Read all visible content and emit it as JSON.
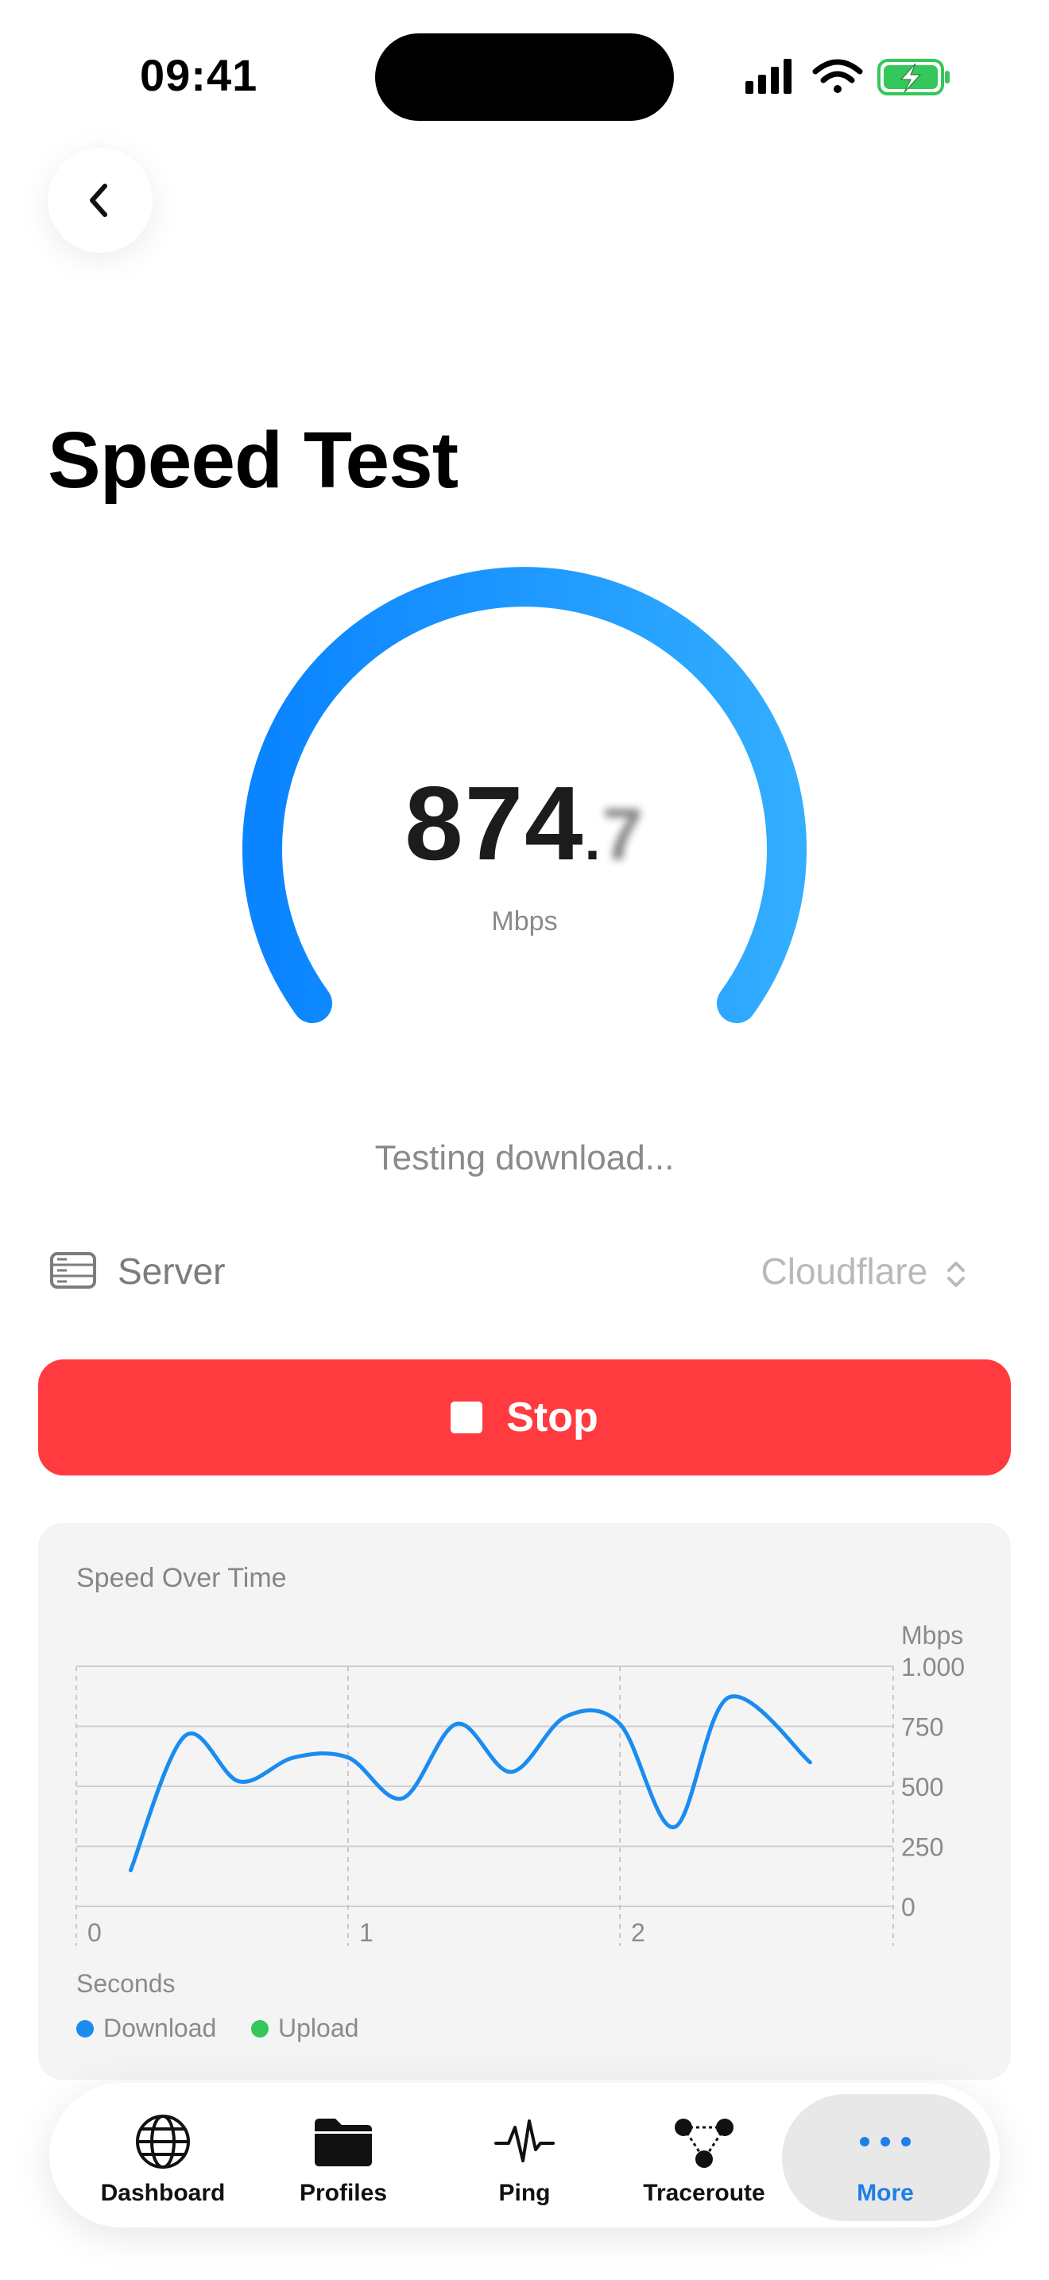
{
  "status_bar": {
    "time": "09:41"
  },
  "page": {
    "title": "Speed Test"
  },
  "gauge": {
    "speed_main": "874",
    "speed_dot": ".",
    "speed_decimal": "7",
    "unit": "Mbps",
    "accent_start": "#0a84ff",
    "accent_end": "#32adff"
  },
  "status": {
    "text": "Testing download..."
  },
  "server": {
    "label": "Server",
    "value": "Cloudflare",
    "icon": "server-icon"
  },
  "stop_button": {
    "label": "Stop",
    "color": "#ff3b3f"
  },
  "chart_data": {
    "type": "line",
    "title": "Speed Over Time",
    "xlabel": "Seconds",
    "ylabel": "Mbps",
    "x_ticks": [
      "0",
      "1",
      "2"
    ],
    "y_ticks": [
      "1.000",
      "750",
      "500",
      "250",
      "0"
    ],
    "ylim": [
      0,
      1000
    ],
    "xlim": [
      0,
      3
    ],
    "grid": true,
    "legend": "bottom-left",
    "series": [
      {
        "name": "Download",
        "color": "#1a8cf0",
        "points": [
          [
            0.2,
            150
          ],
          [
            0.4,
            710
          ],
          [
            0.6,
            520
          ],
          [
            0.8,
            620
          ],
          [
            1.0,
            620
          ],
          [
            1.2,
            450
          ],
          [
            1.4,
            760
          ],
          [
            1.6,
            560
          ],
          [
            1.8,
            790
          ],
          [
            2.0,
            760
          ],
          [
            2.2,
            330
          ],
          [
            2.4,
            870
          ],
          [
            2.7,
            600
          ]
        ]
      },
      {
        "name": "Upload",
        "color": "#34c759",
        "points": []
      }
    ]
  },
  "tabbar": {
    "items": [
      {
        "label": "Dashboard",
        "icon": "globe-icon"
      },
      {
        "label": "Profiles",
        "icon": "folder-icon"
      },
      {
        "label": "Ping",
        "icon": "pulse-icon"
      },
      {
        "label": "Traceroute",
        "icon": "network-icon"
      },
      {
        "label": "More",
        "icon": "more-dots-icon"
      }
    ],
    "active": "More",
    "active_color": "#1d7fe8"
  }
}
